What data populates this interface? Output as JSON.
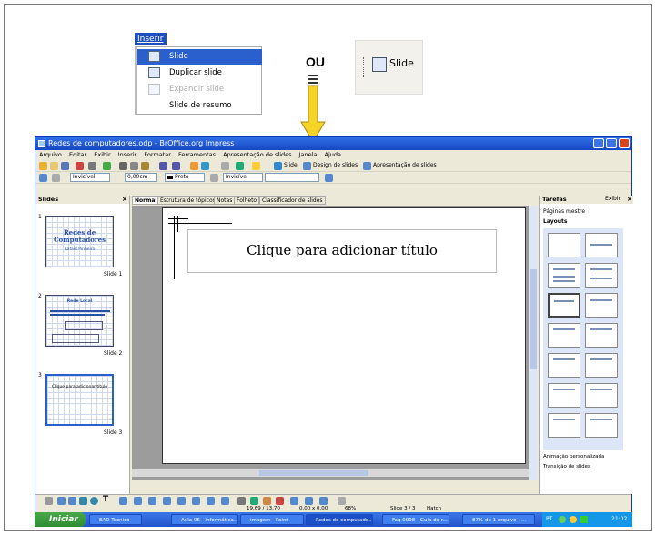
{
  "menu": {
    "title": "Inserir",
    "items": [
      {
        "label": "Slide",
        "state": "selected"
      },
      {
        "label": "Duplicar slide",
        "state": "normal"
      },
      {
        "label": "Expandir slide",
        "state": "disabled"
      },
      {
        "label": "Slide de resumo",
        "state": "normal"
      }
    ]
  },
  "or_label": "OU",
  "slide_button": "Slide",
  "window": {
    "title": "Redes de computadores.odp - BrOffice.org Impress",
    "menubar": [
      "Arquivo",
      "Editar",
      "Exibir",
      "Inserir",
      "Formatar",
      "Ferramentas",
      "Apresentação de slides",
      "Janela",
      "Ajuda"
    ],
    "toolbar2": {
      "slide": "Slide",
      "design": "Design de slides",
      "presentation": "Apresentação de slides"
    },
    "toolbar3": {
      "area": "Invisível",
      "width": "0,00cm",
      "color": "Preto",
      "line": "Invisível"
    },
    "slides_panel_title": "Slides",
    "slides": [
      {
        "num": "1",
        "label": "Slide 1",
        "title": "Redes de Computadores",
        "subtitle": "Rafael Pinheiro"
      },
      {
        "num": "2",
        "label": "Slide 2",
        "title": "Rede Local"
      },
      {
        "num": "3",
        "label": "Slide 3",
        "title": "Clique para adicionar título"
      }
    ],
    "tabs": [
      "Normal",
      "Estrutura de tópicos",
      "Notas",
      "Folheto",
      "Classificador de slides"
    ],
    "title_placeholder": "Clique para adicionar título",
    "tasks": {
      "title": "Tarefas",
      "view": "Exibir",
      "master": "Páginas mestre",
      "layouts": "Layouts",
      "animation": "Animação personalizada",
      "transition": "Transição de slides"
    },
    "status": {
      "pos": "19,69 / 13,70",
      "size": "0,00 x 0,00",
      "zoom": "68%",
      "slide": "Slide 3 / 3",
      "master": "Hatch"
    }
  },
  "taskbar": {
    "start": "Iniciar",
    "items": [
      "EAD Tecnico",
      "Aula 06 - Informática...",
      "imagem - Paint",
      "Redes de computado...",
      "Faq 0008 - Guia do r...",
      "87% de 1 arquivo - ..."
    ],
    "lang": "PT",
    "time": "21:02"
  }
}
